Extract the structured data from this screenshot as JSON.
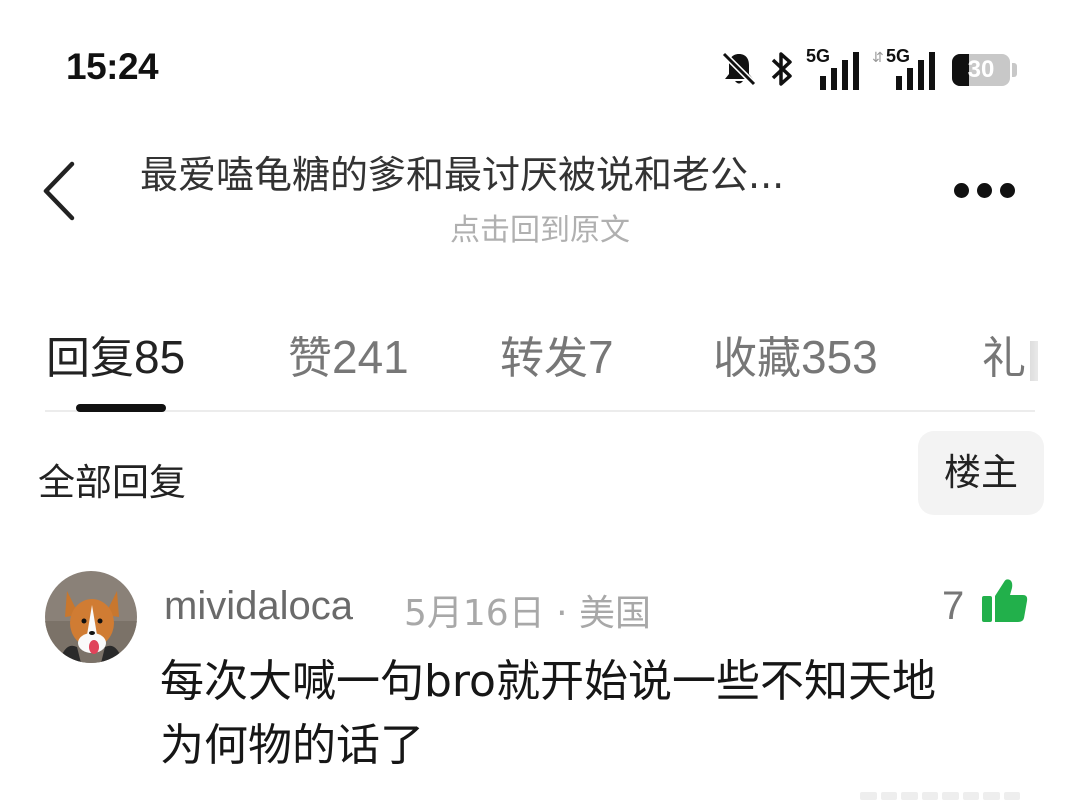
{
  "status_bar": {
    "time": "15:24",
    "network_1": "5G",
    "network_2": "5G",
    "battery": "30",
    "battery_level": 0.3,
    "icons": [
      "bell-off-icon",
      "bluetooth-icon",
      "signal-5g-icon",
      "signal-5g-icon",
      "battery-icon"
    ]
  },
  "header": {
    "title": "最爱嗑龟糖的爹和最讨厌被说和老公...",
    "subtitle": "点击回到原文",
    "back_icon": "chevron-left-icon",
    "more_icon": "more-horizontal-icon"
  },
  "tabs": [
    {
      "label": "回复",
      "count": "85",
      "active": true
    },
    {
      "label": "赞",
      "count": "241",
      "active": false
    },
    {
      "label": "转发",
      "count": "7",
      "active": false
    },
    {
      "label": "收藏",
      "count": "353",
      "active": false
    },
    {
      "label": "礼",
      "count": "",
      "active": false
    }
  ],
  "filter": {
    "all_replies": "全部回复",
    "op_only": "楼主"
  },
  "comments": [
    {
      "username": "mividaloca",
      "date": "5月16日",
      "location": "· 美国",
      "likes": "7",
      "text_line1": "每次大喊一句bro就开始说一些不知天地",
      "text_line2": "为何物的话了",
      "avatar_icon": "corgi-avatar",
      "like_icon": "thumbs-up-icon",
      "like_color": "#22b04b"
    }
  ]
}
